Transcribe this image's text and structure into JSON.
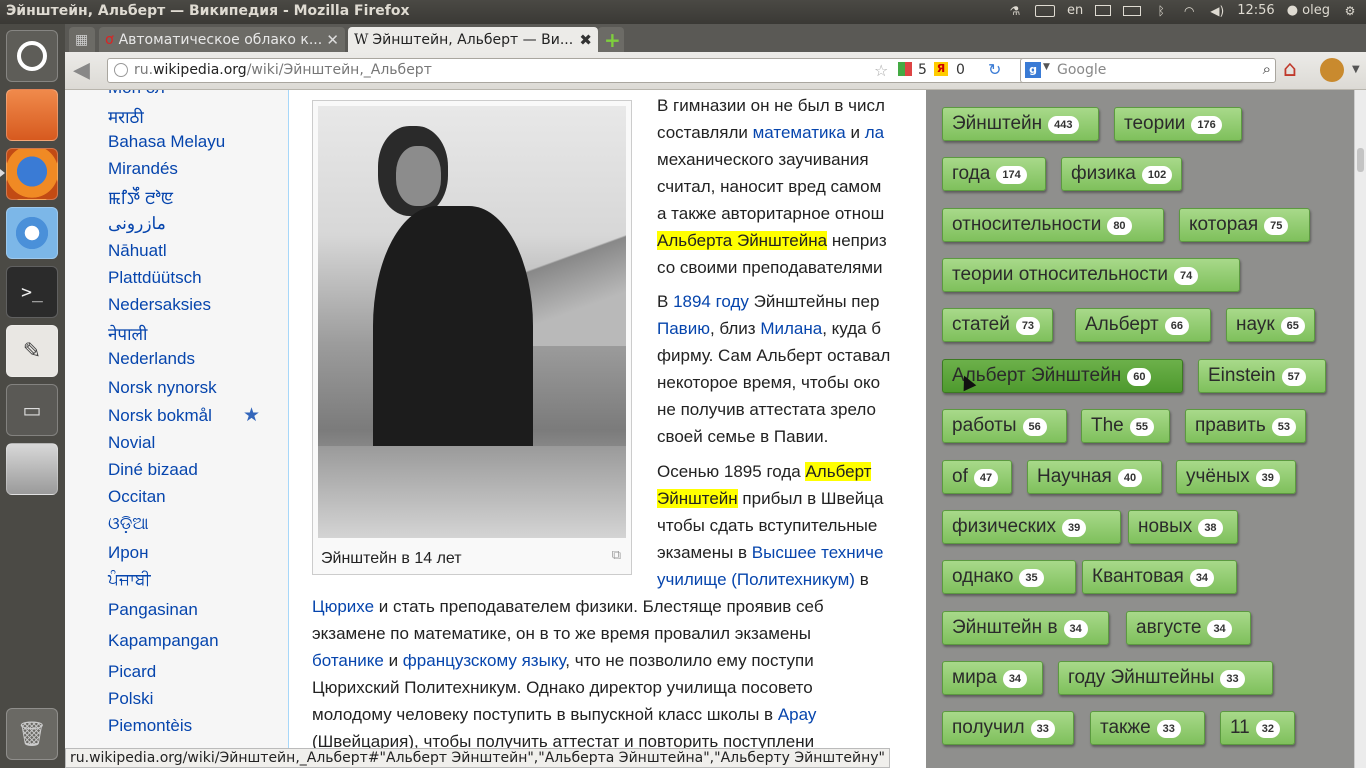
{
  "window": {
    "title": "Эйнштейн, Альберт — Википедия - Mozilla Firefox"
  },
  "tray": {
    "lang": "en",
    "time": "12:56",
    "user": "oleg"
  },
  "launcher": {
    "icons": [
      "ubuntu-icon",
      "files-icon",
      "firefox-icon",
      "chromium-icon",
      "terminal-icon",
      "text-editor-icon",
      "workspaces-icon",
      "disk-icon",
      "trash-icon"
    ]
  },
  "tabs": [
    {
      "label": "Автоматическое облако к..."
    },
    {
      "label": "Эйнштейн, Альберт — Ви..."
    }
  ],
  "nav": {
    "url_domain": "ru.",
    "url_host": "wikipedia.org",
    "url_path": "/wiki/Эйнштейн,_Альберт",
    "counter1": "5",
    "counter2": "0",
    "search_placeholder": "Google"
  },
  "languages": [
    "Mori ол",
    "मराठी",
    "Bahasa Melayu",
    "Mirandés",
    "ꯃꯤꯇꯩ ꯂꯣꯟ",
    "مازرونی",
    "Nāhuatl",
    "Plattdüütsch",
    "Nedersaksies",
    "नेपाली",
    "Nederlands",
    "Norsk nynorsk",
    "Norsk bokmål",
    "Novial",
    "Diné bizaad",
    "Occitan",
    "ଓଡ଼ିଆ",
    "Ирон",
    "ਪੰਜਾਬੀ",
    "Pangasinan",
    "Kapampangan",
    "Picard",
    "Polski",
    "Piemontèis"
  ],
  "article": {
    "caption": "Эйнштейн в 14 лет",
    "l1": "В гимназии он не был в числ",
    "l2a": "составляли ",
    "l2b": "математика",
    "l2c": " и ",
    "l2d": "ла",
    "l3": "механического заучивания",
    "l4": "считал, наносит вред самом",
    "l5": "а также авторитарное отнош",
    "l6a": "Альберта Эйнштейна",
    "l6b": " неприз",
    "l7": "со своими преподавателями",
    "l8a": "В ",
    "l8b": "1894 году",
    "l8c": " Эйнштейны пер",
    "l9a": "Павию",
    "l9b": ", близ ",
    "l9c": "Милана",
    "l9d": ", куда б",
    "l10": "фирму. Сам Альберт оставал",
    "l11": "некоторое время, чтобы око",
    "l12": "не получив аттестата зрело",
    "l13": "своей семье в Павии.",
    "l14a": "Осенью 1895 года ",
    "l14b": "Альберт",
    "l15a": "Эйнштейн",
    "l15b": " прибыл в Швейца",
    "l16": "чтобы сдать вступительные",
    "l17a": "экзамены в ",
    "l17b": "Высшее техниче",
    "l18a": "училище (Политехникум)",
    "l18b": " в",
    "l19a": "Цюрихе",
    "l19b": " и стать преподавателем физики. Блестяще проявив себ",
    "l20": "экзамене по математике, он в то же время провалил экзамены",
    "l21a": "ботанике",
    "l21b": " и ",
    "l21c": "французскому языку",
    "l21d": ", что не позволило ему поступи",
    "l22": "Цюрихский Политехникум. Однако директор училища посовето",
    "l23a": "молодому человеку поступить в выпускной класс школы в ",
    "l23b": "Арау",
    "l24": "(Швейцария), чтобы получить аттестат и повторить поступлени"
  },
  "tags": [
    {
      "word": "Эйнштейн",
      "count": "443"
    },
    {
      "word": "теории",
      "count": "176"
    },
    {
      "word": "года",
      "count": "174"
    },
    {
      "word": "физика",
      "count": "102"
    },
    {
      "word": "относительности",
      "count": "80"
    },
    {
      "word": "которая",
      "count": "75"
    },
    {
      "word": "теории относительности",
      "count": "74"
    },
    {
      "word": "статей",
      "count": "73"
    },
    {
      "word": "Альберт",
      "count": "66"
    },
    {
      "word": "наук",
      "count": "65"
    },
    {
      "word": "Альберт Эйнштейн",
      "count": "60"
    },
    {
      "word": "Einstein",
      "count": "57"
    },
    {
      "word": "работы",
      "count": "56"
    },
    {
      "word": "The",
      "count": "55"
    },
    {
      "word": "править",
      "count": "53"
    },
    {
      "word": "of",
      "count": "47"
    },
    {
      "word": "Научная",
      "count": "40"
    },
    {
      "word": "учёных",
      "count": "39"
    },
    {
      "word": "физических",
      "count": "39"
    },
    {
      "word": "новых",
      "count": "38"
    },
    {
      "word": "однако",
      "count": "35"
    },
    {
      "word": "Квантовая",
      "count": "34"
    },
    {
      "word": "Эйнштейн в",
      "count": "34"
    },
    {
      "word": "августе",
      "count": "34"
    },
    {
      "word": "мира",
      "count": "34"
    },
    {
      "word": "году Эйнштейны",
      "count": "33"
    },
    {
      "word": "получил",
      "count": "33"
    },
    {
      "word": "также",
      "count": "33"
    },
    {
      "word": "11",
      "count": "32"
    }
  ],
  "status": "ru.wikipedia.org/wiki/Эйнштейн,_Альберт#\"Альберт Эйнштейн\",\"Альберта Эйнштейна\",\"Альберту Эйнштейну\"",
  "colors": {
    "tag_bg": "#8fcd6b",
    "tag_selected": "#5aa63a",
    "link": "#0645ad",
    "highlight": "#ffff00"
  }
}
